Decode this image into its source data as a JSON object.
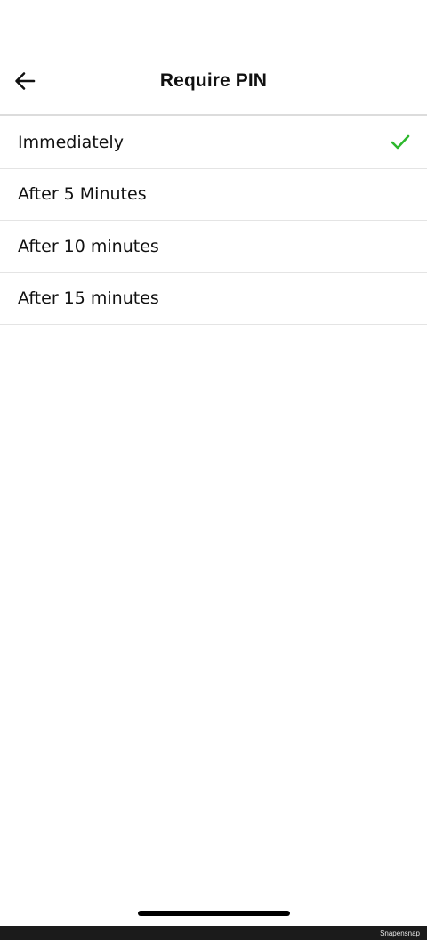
{
  "header": {
    "title": "Require PIN",
    "back_icon": "arrow-left-icon"
  },
  "options": [
    {
      "label": "Immediately",
      "selected": true
    },
    {
      "label": "After 5 Minutes",
      "selected": false
    },
    {
      "label": "After 10 minutes",
      "selected": false
    },
    {
      "label": "After 15 minutes",
      "selected": false
    }
  ],
  "colors": {
    "check": "#2db82d",
    "divider": "#e4e4e4",
    "text": "#111111"
  },
  "footer": {
    "watermark": "Snapensnap"
  }
}
